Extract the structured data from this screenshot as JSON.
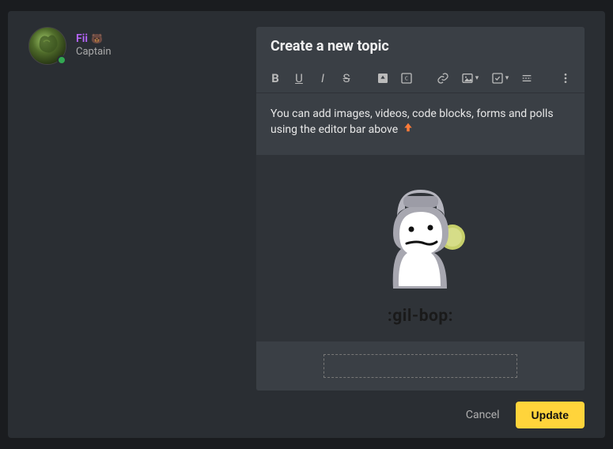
{
  "user": {
    "name": "Fii",
    "badge_emoji": "🐻",
    "role": "Captain",
    "status": "online"
  },
  "editor": {
    "title": "Create a new topic",
    "hint": "You can add images, videos, code blocks, forms and polls using the editor bar above",
    "arrow_emoji": "⬆",
    "caption_value": ""
  },
  "emote": {
    "label": ":gil-bop:"
  },
  "actions": {
    "cancel": "Cancel",
    "update": "Update"
  },
  "colors": {
    "accent": "#ffd43b",
    "username": "#b866ff",
    "arrow": "#ff7b39"
  }
}
